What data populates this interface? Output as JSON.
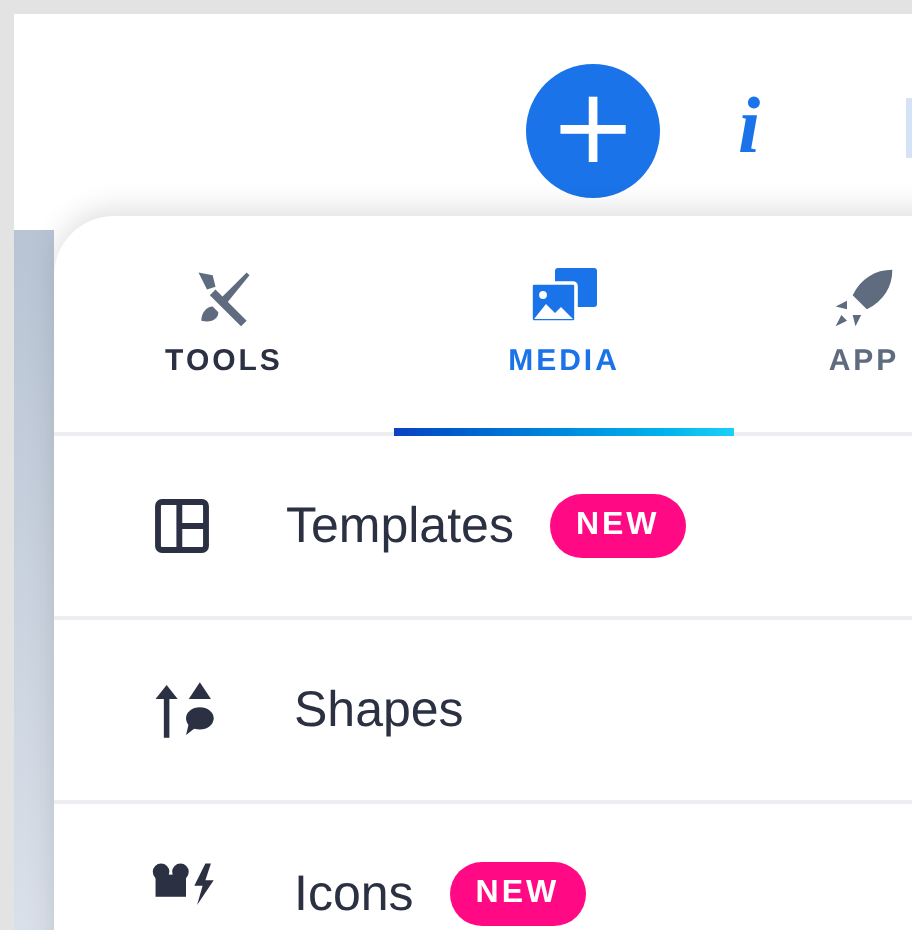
{
  "toolbar": {
    "add_button": {
      "label": "+"
    },
    "info_button": {
      "label": "i"
    }
  },
  "tabs": [
    {
      "label": "TOOLS",
      "selected": false,
      "kind": "tools"
    },
    {
      "label": "MEDIA",
      "selected": true,
      "kind": "media"
    },
    {
      "label": "APP",
      "selected": false,
      "kind": "apps"
    }
  ],
  "items": [
    {
      "label": "Templates",
      "badge": "NEW",
      "kind": "templates"
    },
    {
      "label": "Shapes",
      "kind": "shapes"
    },
    {
      "label": "Icons",
      "badge": "NEW",
      "kind": "icons"
    }
  ]
}
